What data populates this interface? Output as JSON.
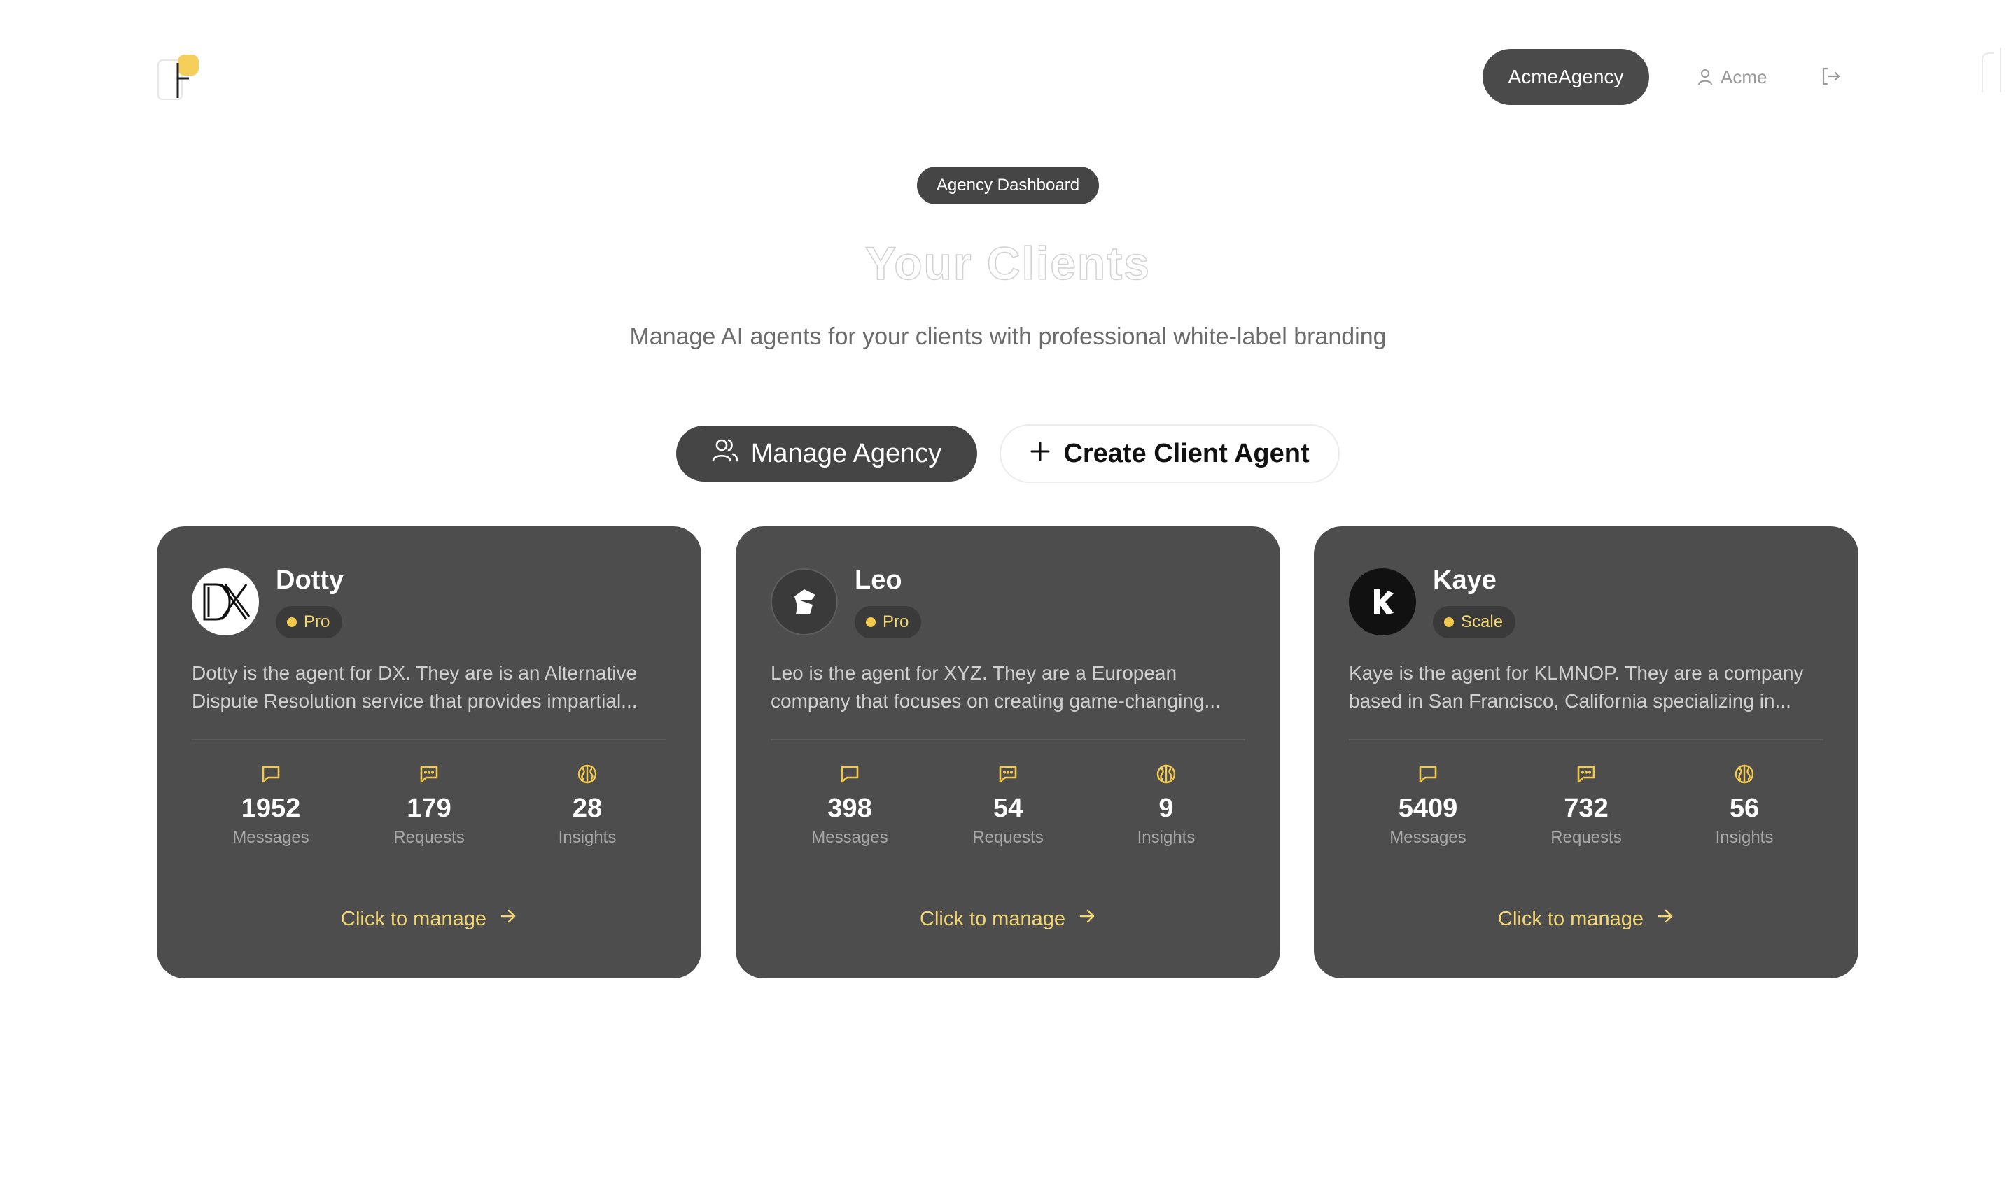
{
  "header": {
    "agency_name": "AcmeAgency",
    "user_name": "Acme"
  },
  "hero": {
    "badge": "Agency Dashboard",
    "title": "Your Clients",
    "subtitle": "Manage AI agents for your clients with professional white-label branding"
  },
  "actions": {
    "manage_label": "Manage Agency",
    "create_label": "Create Client Agent"
  },
  "colors": {
    "card_bg": "#4d4d4d",
    "accent_yellow": "#f2c94c",
    "dark_pill": "#454545"
  },
  "clients": [
    {
      "name": "Dotty",
      "plan": "Pro",
      "avatar": "dx-logo",
      "description": "Dotty is the agent for DX. They are is an Alternative Dispute Resolution service that provides impartial...",
      "stats": [
        {
          "value": "1952",
          "label": "Messages",
          "icon": "message-icon"
        },
        {
          "value": "179",
          "label": "Requests",
          "icon": "request-icon"
        },
        {
          "value": "28",
          "label": "Insights",
          "icon": "brain-icon"
        }
      ],
      "manage_label": "Click to manage"
    },
    {
      "name": "Leo",
      "plan": "Pro",
      "avatar": "leo-logo",
      "description": "Leo is the agent for XYZ. They are a European company that focuses on creating game-changing...",
      "stats": [
        {
          "value": "398",
          "label": "Messages",
          "icon": "message-icon"
        },
        {
          "value": "54",
          "label": "Requests",
          "icon": "request-icon"
        },
        {
          "value": "9",
          "label": "Insights",
          "icon": "brain-icon"
        }
      ],
      "manage_label": "Click to manage"
    },
    {
      "name": "Kaye",
      "plan": "Scale",
      "avatar": "k-logo",
      "description": "Kaye is the agent for KLMNOP. They are a company based in San Francisco, California specializing in...",
      "stats": [
        {
          "value": "5409",
          "label": "Messages",
          "icon": "message-icon"
        },
        {
          "value": "732",
          "label": "Requests",
          "icon": "request-icon"
        },
        {
          "value": "56",
          "label": "Insights",
          "icon": "brain-icon"
        }
      ],
      "manage_label": "Click to manage"
    }
  ]
}
